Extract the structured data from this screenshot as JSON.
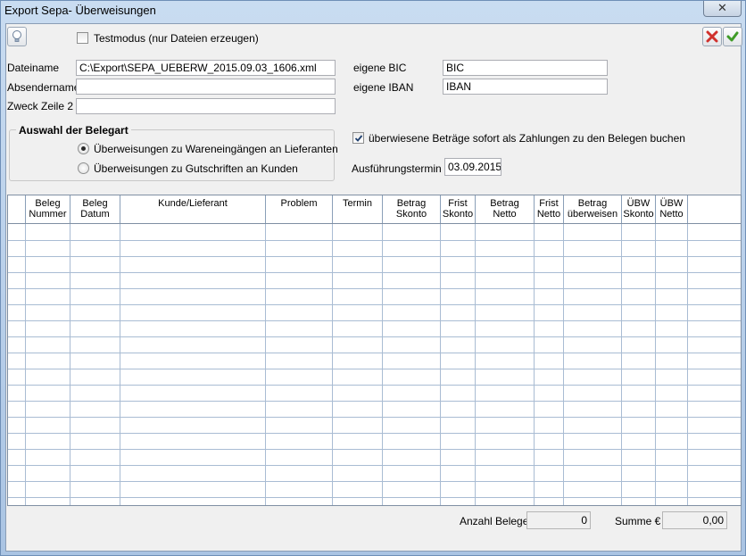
{
  "window": {
    "title": "Export Sepa- Überweisungen",
    "close_glyph": "✕"
  },
  "toolbar": {
    "bulb_icon": "lightbulb-icon",
    "testmode_label": "Testmodus (nur Dateien erzeugen)",
    "testmode_checked": false,
    "cancel_icon": "red-x-icon",
    "ok_icon": "green-check-icon"
  },
  "form": {
    "dateiname_label": "Dateiname",
    "dateiname_value": "C:\\Export\\SEPA_UEBERW_2015.09.03_1606.xml",
    "absendername_label": "Absendername",
    "absendername_value": "",
    "zweck_label": "Zweck Zeile 2",
    "zweck_value": "",
    "bic_label": "eigene BIC",
    "bic_value": "BIC",
    "iban_label": "eigene IBAN",
    "iban_value": "IBAN"
  },
  "belegart": {
    "title": "Auswahl der Belegart",
    "option1": "Überweisungen zu Wareneingängen an Lieferanten",
    "option2": "Überweisungen zu Gutschriften an Kunden",
    "selected": 1
  },
  "booking": {
    "label": "überwiesene Beträge sofort als Zahlungen zu den Belegen buchen",
    "checked": true,
    "termin_label": "Ausführungstermin",
    "termin_value": "03.09.2015"
  },
  "table": {
    "columns": [
      [
        "Beleg",
        "Nummer"
      ],
      [
        "Beleg",
        "Datum"
      ],
      [
        "Kunde/Lieferant",
        ""
      ],
      [
        "Problem",
        ""
      ],
      [
        "Termin",
        ""
      ],
      [
        "Betrag",
        "Skonto"
      ],
      [
        "Frist",
        "Skonto"
      ],
      [
        "Betrag",
        "Netto"
      ],
      [
        "Frist",
        "Netto"
      ],
      [
        "Betrag",
        "überweisen"
      ],
      [
        "ÜBW",
        "Skonto"
      ],
      [
        "ÜBW",
        "Netto"
      ]
    ],
    "rows": []
  },
  "footer": {
    "anzahl_label": "Anzahl Belege",
    "anzahl_value": "0",
    "summe_label": "Summe €",
    "summe_value": "0,00"
  },
  "colors": {
    "accent": "#2a5f9e",
    "cancel": "#d0312d",
    "ok": "#3f9b27"
  }
}
